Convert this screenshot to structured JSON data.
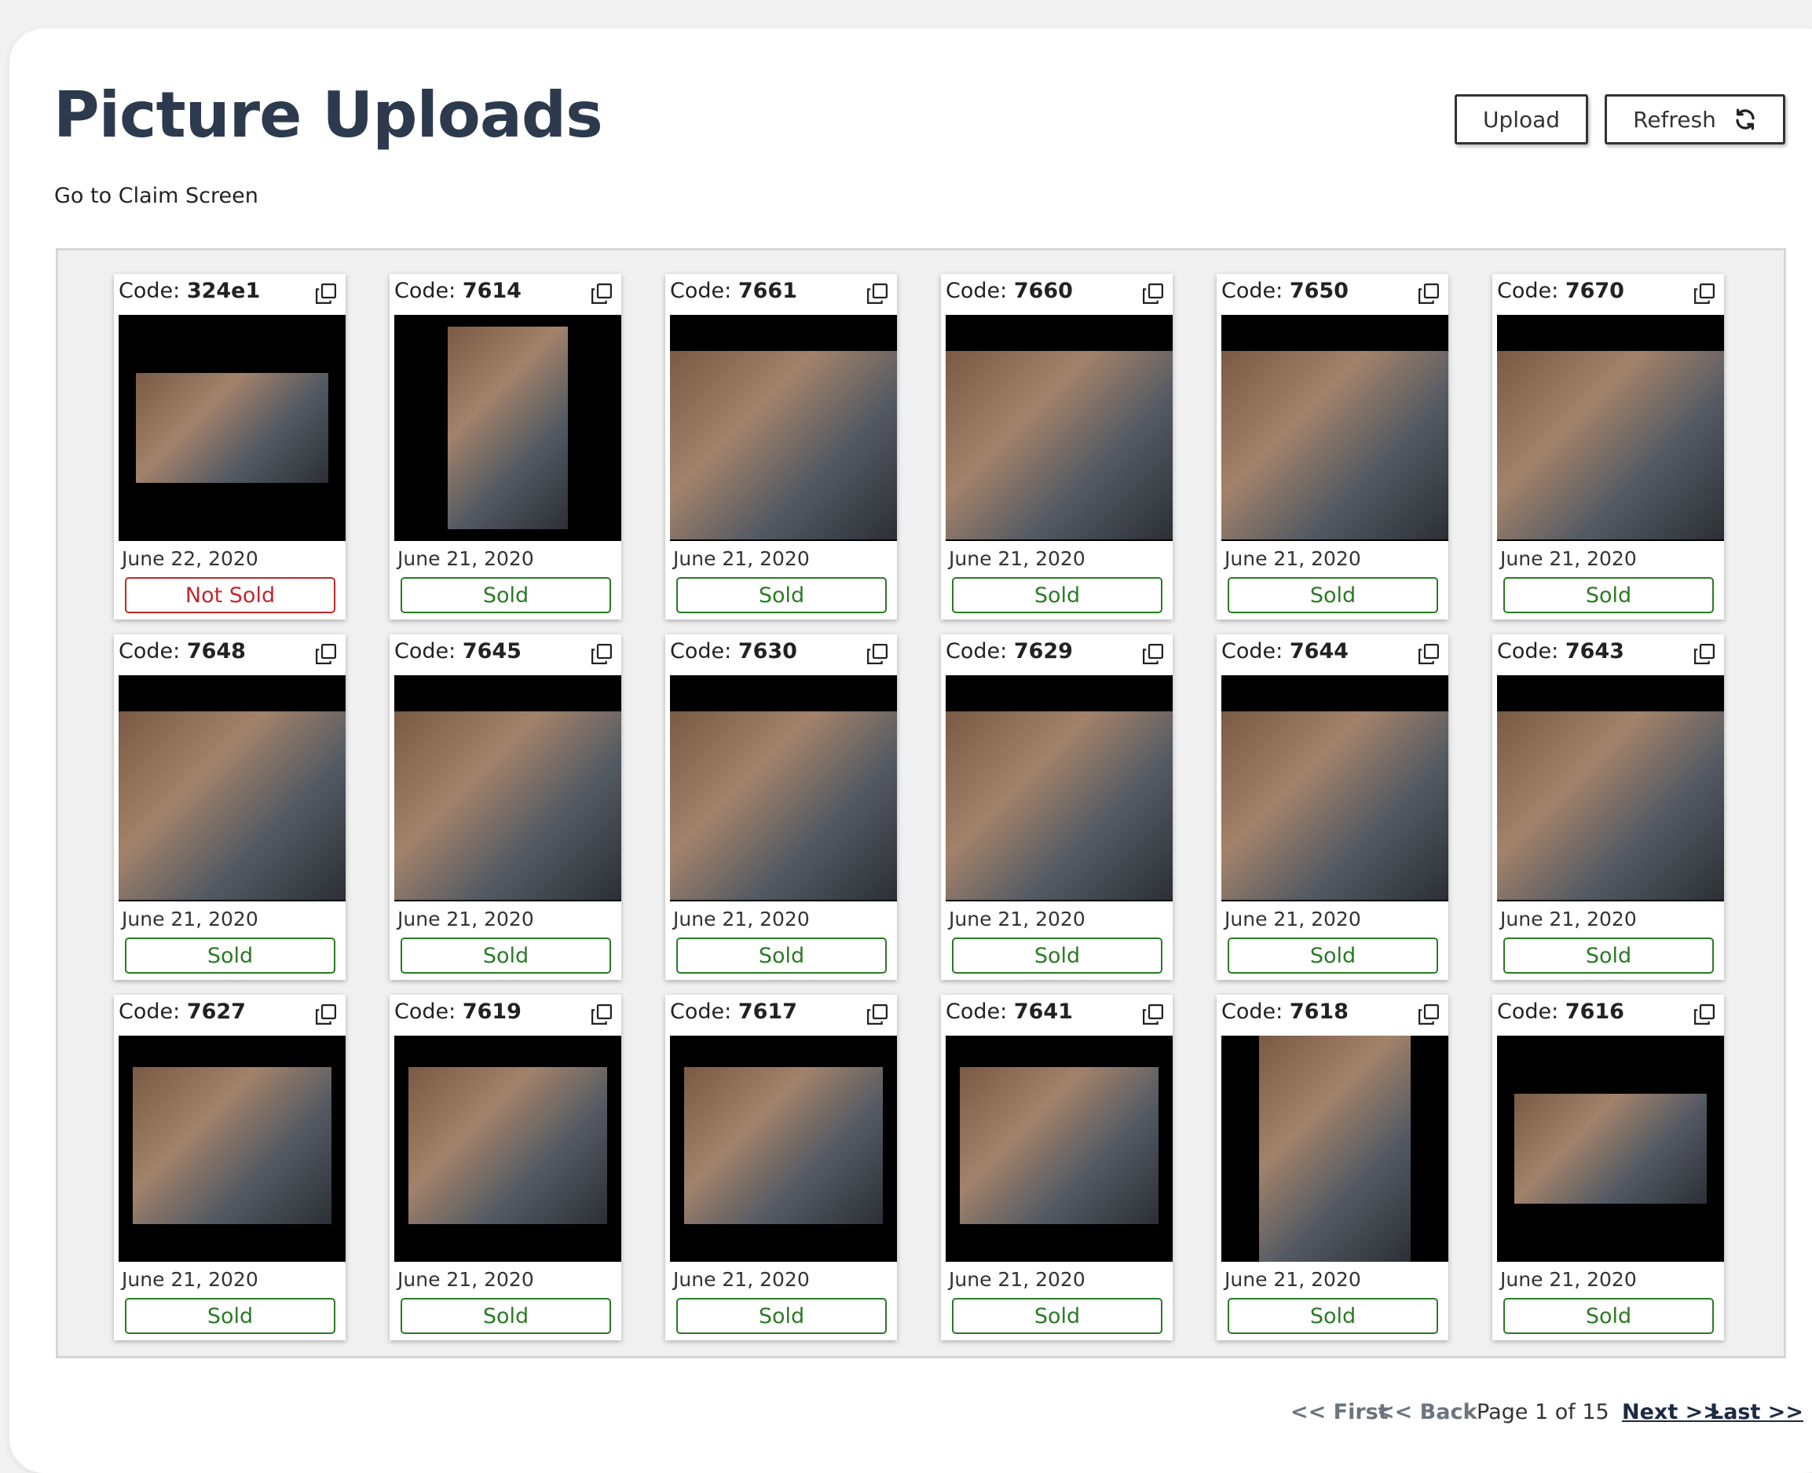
{
  "header": {
    "title": "Picture Uploads",
    "claim_link": "Go to Claim Screen",
    "upload_label": "Upload",
    "refresh_label": "Refresh",
    "refresh_icon": "refresh-icon"
  },
  "card_labels": {
    "code_prefix": "Code: ",
    "copy_icon": "copy-icon"
  },
  "status_colors": {
    "sold": "#2b7a25",
    "not_sold": "#c0282d"
  },
  "cards": [
    {
      "code": "324e1",
      "date": "June 22, 2020",
      "status": "Not Sold"
    },
    {
      "code": "7614",
      "date": "June 21, 2020",
      "status": "Sold"
    },
    {
      "code": "7661",
      "date": "June 21, 2020",
      "status": "Sold"
    },
    {
      "code": "7660",
      "date": "June 21, 2020",
      "status": "Sold"
    },
    {
      "code": "7650",
      "date": "June 21, 2020",
      "status": "Sold"
    },
    {
      "code": "7670",
      "date": "June 21, 2020",
      "status": "Sold"
    },
    {
      "code": "7648",
      "date": "June 21, 2020",
      "status": "Sold"
    },
    {
      "code": "7645",
      "date": "June 21, 2020",
      "status": "Sold"
    },
    {
      "code": "7630",
      "date": "June 21, 2020",
      "status": "Sold"
    },
    {
      "code": "7629",
      "date": "June 21, 2020",
      "status": "Sold"
    },
    {
      "code": "7644",
      "date": "June 21, 2020",
      "status": "Sold"
    },
    {
      "code": "7643",
      "date": "June 21, 2020",
      "status": "Sold"
    },
    {
      "code": "7627",
      "date": "June 21, 2020",
      "status": "Sold"
    },
    {
      "code": "7619",
      "date": "June 21, 2020",
      "status": "Sold"
    },
    {
      "code": "7617",
      "date": "June 21, 2020",
      "status": "Sold"
    },
    {
      "code": "7641",
      "date": "June 21, 2020",
      "status": "Sold"
    },
    {
      "code": "7618",
      "date": "June 21, 2020",
      "status": "Sold"
    },
    {
      "code": "7616",
      "date": "June 21, 2020",
      "status": "Sold"
    }
  ],
  "pagination": {
    "first_label": "<< First",
    "back_label": "<< Back",
    "status": "Page 1 of 15",
    "next_label": "Next >> ",
    "last_label": "Last >>"
  }
}
